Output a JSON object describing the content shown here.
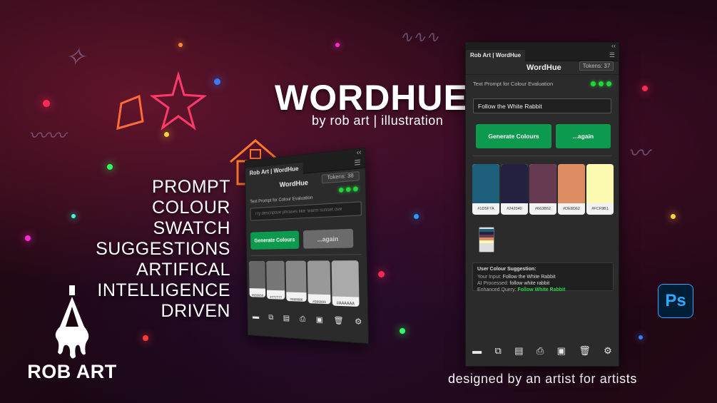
{
  "hero": {
    "title": "WORDHUE",
    "subtitle": "by rob art | illustration",
    "taglines": [
      "PROMPT",
      "COLOUR",
      "SWATCH",
      "SUGGESTIONS",
      "ARTIFICAL",
      "INTELLIGENCE",
      "DRIVEN"
    ],
    "footer": "designed by an artist for artists"
  },
  "logos": {
    "robart_text": "ROB ART",
    "photoshop_text": "Ps"
  },
  "panel_left": {
    "tab": "Rob Art | WordHue",
    "name": "WordHue",
    "tokens": "Tokens: 38",
    "prompt_label": "Text Prompt for Colour Evaluation",
    "input_value": "",
    "input_placeholder": "Try descriptive phrases like 'warm sunset ove",
    "generate_label": "Generate Colours",
    "again_label": "...again",
    "swatches": [
      {
        "hex": "#666666",
        "color": "#666666"
      },
      {
        "hex": "#777777",
        "color": "#777777"
      },
      {
        "hex": "#888888",
        "color": "#888888"
      },
      {
        "hex": "#999999",
        "color": "#999999"
      },
      {
        "hex": "#AAAAAA",
        "color": "#aaaaaa"
      }
    ]
  },
  "panel_right": {
    "tab": "Rob Art | WordHue",
    "name": "WordHue",
    "tokens": "Tokens: 37",
    "prompt_label": "Text Prompt for Colour Evaluation",
    "input_value": "Follow the White Rabbit",
    "generate_label": "Generate Colours",
    "again_label": "...again",
    "swatches": [
      {
        "hex": "#1D5F7A",
        "color": "#1D5F7A"
      },
      {
        "hex": "#242040",
        "color": "#242040"
      },
      {
        "hex": "#663B52",
        "color": "#663B52"
      },
      {
        "hex": "#DE8D62",
        "color": "#DE8D62"
      },
      {
        "hex": "#FCF9B1",
        "color": "#FCF9B1"
      }
    ],
    "suggestion": {
      "heading": "User Colour Suggestion:",
      "input_label": "Your Input:",
      "input_value": "Follow the White Rabbit",
      "processed_label": "AI Processed:",
      "processed_value": "follow white rabbit",
      "query_label": "Enhanced Query:",
      "query_value": "Follow White Rabbit"
    }
  },
  "toolbar_icons": [
    "minus-icon",
    "duplicate-icon",
    "document-icon",
    "print-icon",
    "save-icon",
    "trash-icon",
    "gear-icon"
  ],
  "colors": {
    "accent_green": "#0e9a4e",
    "status_led": "#22d63a",
    "panel_bg": "#2b2b2b"
  }
}
